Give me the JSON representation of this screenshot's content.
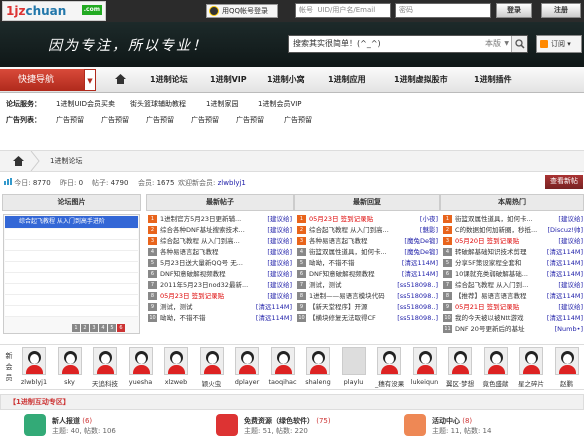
{
  "topbar": {
    "logo_text": "1jz",
    "logo_text2": "chuan",
    "logo_tag": ".com",
    "qq_login": "用QQ帐号登录",
    "account_label": "帐号",
    "account_placeholder": "UID/用户名/Email",
    "password_placeholder": "密码",
    "login": "登录",
    "register": "注册"
  },
  "banner": {
    "slogan": "因为专注，所以专业！",
    "search_placeholder": "搜索其实很简单！(^_^)",
    "search_scope": "本版",
    "subscribe": "订阅"
  },
  "nav": {
    "quick": "快捷导航",
    "items": [
      "1进制论坛",
      "1进制VIP",
      "1进制小窝",
      "1进制应用",
      "1进制虚拟股市",
      "1进制插件"
    ]
  },
  "sub": {
    "services_label": "论坛服务：",
    "services": [
      "1进制UID会员买卖",
      "街头篮球辅助教程",
      "1进制家园",
      "1进制会员VIP"
    ],
    "ads_label": "广告列表：",
    "ads": [
      "广告预留",
      "广告预留",
      "广告预留",
      "广告预留",
      "广告预留",
      "广告预留"
    ]
  },
  "crumb": {
    "text": "1进制论坛"
  },
  "stats": {
    "today_label": "今日:",
    "today": "8770",
    "yesterday_label": "昨日:",
    "yesterday": "0",
    "posts_label": "帖子:",
    "posts": "4790",
    "members_label": "会员:",
    "members": "1675",
    "welcome_label": "欢迎新会员:",
    "newest": "zlwblyj1",
    "new_post": "查看新帖"
  },
  "columns": {
    "pics": "论坛图片",
    "newest": "最新帖子",
    "reply": "最新回复",
    "hot": "本周热门"
  },
  "pic_caption": "综合起飞教程 从入门到高手进阶",
  "pager": [
    "1",
    "2",
    "3",
    "4",
    "5",
    "6"
  ],
  "newest": [
    {
      "n": "1",
      "t": "1进制官方5月23日更新辅...",
      "tag": "[建议给]",
      "red": false
    },
    {
      "n": "2",
      "t": "综合各种DNF基址搜索技术...",
      "tag": "[建议给]",
      "red": false
    },
    {
      "n": "3",
      "t": "综合起飞教程 从入门到高...",
      "tag": "[建议给]",
      "red": false
    },
    {
      "n": "4",
      "t": "各种易语言起飞教程",
      "tag": "[建议给]",
      "red": false
    },
    {
      "n": "5",
      "t": "5月23日送大量新QQ号 无...",
      "tag": "[建议给]",
      "red": false
    },
    {
      "n": "6",
      "t": "DNF知意破解视频教程",
      "tag": "[建议给]",
      "red": false
    },
    {
      "n": "7",
      "t": "2011年5月23日nod32最新...",
      "tag": "[建议给]",
      "red": false
    },
    {
      "n": "8",
      "t": "05月23日 签到记录贴",
      "tag": "[建议给]",
      "red": true
    },
    {
      "n": "9",
      "t": "测试，测试",
      "tag": "[清远114M]",
      "red": false
    },
    {
      "n": "10",
      "t": "呦呦，不错不错",
      "tag": "[清远114M]",
      "red": false
    }
  ],
  "reply": [
    {
      "n": "1",
      "t": "05月23日 签到记录贴",
      "tag": "[小夜]",
      "red": true
    },
    {
      "n": "2",
      "t": "综合起飞教程 从入门到高...",
      "tag": "[魅影]",
      "red": false
    },
    {
      "n": "3",
      "t": "各种易语言起飞教程",
      "tag": "[魔兔De锻]",
      "red": false
    },
    {
      "n": "4",
      "t": "街篮双属性道具，如何卡...",
      "tag": "[魔兔De锻]",
      "red": false
    },
    {
      "n": "5",
      "t": "呦呦，不错不错",
      "tag": "[清远114M]",
      "red": false
    },
    {
      "n": "6",
      "t": "DNF知意破解视频教程",
      "tag": "[清远114M]",
      "red": false
    },
    {
      "n": "7",
      "t": "测试，测试",
      "tag": "[ss518098..]",
      "red": false
    },
    {
      "n": "8",
      "t": "1进制——易语言模块代码",
      "tag": "[ss518098..]",
      "red": false
    },
    {
      "n": "9",
      "t": "【新天堂程序】开源",
      "tag": "[ss518098..]",
      "red": false
    },
    {
      "n": "10",
      "t": "【横块修复无法取得CF",
      "tag": "[ss518098..]",
      "red": false
    }
  ],
  "hot": [
    {
      "n": "1",
      "t": "街篮双属性道具，如何卡...",
      "tag": "[建议给]",
      "red": false
    },
    {
      "n": "2",
      "t": "C的数据如何加新圈，秒抵...",
      "tag": "[Discuz!帅]",
      "red": false
    },
    {
      "n": "3",
      "t": "05月20日 签到记录贴",
      "tag": "[建议给]",
      "red": true
    },
    {
      "n": "4",
      "t": "转破解基础知识技术剪理",
      "tag": "[清远114M]",
      "red": false
    },
    {
      "n": "5",
      "t": "分享5F策设家程全套和",
      "tag": "[清远114M]",
      "red": false
    },
    {
      "n": "6",
      "t": "10课就充类弱破解基础...",
      "tag": "[清远114M]",
      "red": false
    },
    {
      "n": "7",
      "t": "综合起飞教程 从入门到...",
      "tag": "[建议给]",
      "red": false
    },
    {
      "n": "8",
      "t": "【推荐】易语言语言教程",
      "tag": "[清远114M]",
      "red": false
    },
    {
      "n": "9",
      "t": "05月21日 签到记录贴",
      "tag": "[建议给]",
      "red": true
    },
    {
      "n": "10",
      "t": "我的今天被以被Ntt游戏",
      "tag": "[清远114M]",
      "red": false
    },
    {
      "n": "11",
      "t": "DNF 20号更新后的基址",
      "tag": "[Numb•]",
      "red": false
    }
  ],
  "members_label": "新会员",
  "members": [
    "zlwblyj1",
    "sky",
    "天追科技",
    "yuesha",
    "xlzweb",
    "颖火虫",
    "dplayer",
    "taoqihac",
    "shaleng",
    "playlu",
    "_穗有没果",
    "lukeiqun",
    "翼区·梦想",
    "竟色盛献",
    "星之碎片",
    "赵鹏"
  ],
  "zone": {
    "title": "【1进制互动专区】",
    "items": [
      {
        "name": "新人报道",
        "count": "(6)",
        "sub": "主题: 40, 帖数: 106"
      },
      {
        "name": "免费资源（绿色软件）",
        "count": "(75)",
        "sub": "主题: 51, 帖数: 220"
      },
      {
        "name": "活动中心",
        "count": "(8)",
        "sub": "主题: 11, 帖数: 14"
      }
    ]
  }
}
